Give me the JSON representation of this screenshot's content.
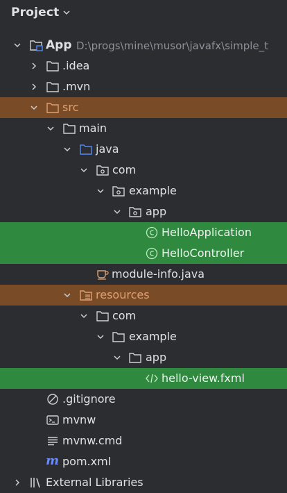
{
  "panel": {
    "title": "Project"
  },
  "tree": [
    {
      "id": "app",
      "label": "App",
      "path": "D:\\progs\\mine\\musor\\javafx\\simple_t",
      "expanded": true,
      "icon": "module-folder-icon"
    },
    {
      "id": "idea",
      "label": ".idea",
      "expanded": false,
      "icon": "folder-icon"
    },
    {
      "id": "mvn",
      "label": ".mvn",
      "expanded": false,
      "icon": "folder-icon"
    },
    {
      "id": "src",
      "label": "src",
      "expanded": true,
      "icon": "source-folder-icon"
    },
    {
      "id": "main",
      "label": "main",
      "expanded": true,
      "icon": "folder-icon"
    },
    {
      "id": "java",
      "label": "java",
      "expanded": true,
      "icon": "java-source-root-icon"
    },
    {
      "id": "com",
      "label": "com",
      "expanded": true,
      "icon": "package-icon"
    },
    {
      "id": "example",
      "label": "example",
      "expanded": true,
      "icon": "package-icon"
    },
    {
      "id": "app-pkg",
      "label": "app",
      "expanded": true,
      "icon": "package-icon"
    },
    {
      "id": "hello-app",
      "label": "HelloApplication",
      "icon": "class-icon"
    },
    {
      "id": "hello-ctrl",
      "label": "HelloController",
      "icon": "class-icon"
    },
    {
      "id": "module-info",
      "label": "module-info.java",
      "icon": "java-module-icon"
    },
    {
      "id": "resources",
      "label": "resources",
      "expanded": true,
      "icon": "resources-root-icon"
    },
    {
      "id": "res-com",
      "label": "com",
      "expanded": true,
      "icon": "folder-icon"
    },
    {
      "id": "res-example",
      "label": "example",
      "expanded": true,
      "icon": "folder-icon"
    },
    {
      "id": "res-app",
      "label": "app",
      "expanded": true,
      "icon": "folder-icon"
    },
    {
      "id": "hello-view",
      "label": "hello-view.fxml",
      "icon": "fxml-icon"
    },
    {
      "id": "gitignore",
      "label": ".gitignore",
      "icon": "gitignore-icon"
    },
    {
      "id": "mvnw",
      "label": "mvnw",
      "icon": "terminal-icon"
    },
    {
      "id": "mvnw-cmd",
      "label": "mvnw.cmd",
      "icon": "text-file-icon"
    },
    {
      "id": "pom",
      "label": "pom.xml",
      "icon": "maven-icon"
    },
    {
      "id": "ext-libs",
      "label": "External Libraries",
      "expanded": false,
      "icon": "libraries-icon"
    }
  ],
  "colors": {
    "background": "#2b2d30",
    "selection_orange": "#7a4b27",
    "selection_green": "#2f8a3f",
    "folder_stroke": "#ced0d6",
    "java_folder": "#548af7",
    "resources_folder": "#e08855",
    "class_icon": "#5fb865",
    "fxml_icon": "#5fb865",
    "maven_icon": "#6e8cf7"
  }
}
